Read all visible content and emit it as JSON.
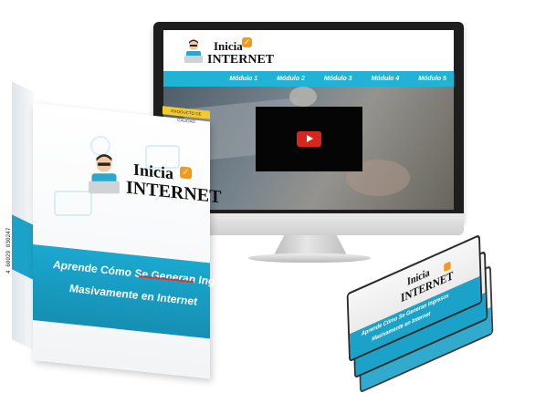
{
  "site": {
    "logo_line1": "Inicia",
    "logo_line2": "INTERNET",
    "nav": [
      "Módulo 1",
      "Módulo 2",
      "Módulo 3",
      "Módulo 4",
      "Módulo 5"
    ]
  },
  "box": {
    "tag": "PRODUCTO DE CALIDAD",
    "logo_line1": "Inicia",
    "logo_line2": "INTERNET",
    "tagline_part1": "Aprende Cómo Se Generan Ingresos",
    "tagline_part2": "Masivamente en Internet",
    "barcode_number": "4 60029 030247"
  },
  "dvd": {
    "logo_line1": "Inicia",
    "logo_line2": "INTERNET",
    "tagline_part1": "Aprende Cómo Se Generan Ingresos",
    "tagline_part2": "Masivamente en Internet"
  },
  "colors": {
    "accent": "#21b3d6",
    "band": "#1aa8cf",
    "badge": "#f39a1d",
    "play": "#d8261f"
  },
  "icons": [
    "person-laptop-icon",
    "checkmark-badge-icon",
    "play-icon"
  ]
}
